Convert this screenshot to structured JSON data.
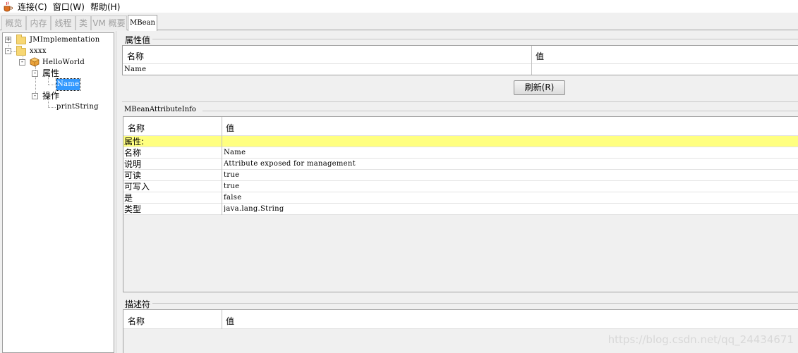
{
  "menubar": {
    "app_icon": "java-coffee-icon",
    "items": [
      "连接(C)",
      "窗口(W)",
      "帮助(H)"
    ]
  },
  "tabs": [
    "概览",
    "内存",
    "线程",
    "类",
    "VM 概要",
    "MBean"
  ],
  "tree": {
    "nodes": [
      "JMImplementation",
      "xxxx",
      "HelloWorld",
      "属性",
      "Name",
      "操作",
      "printString"
    ],
    "expanders": [
      "+",
      "-",
      "-",
      "-",
      "-"
    ]
  },
  "attr_values": {
    "title": "属性值",
    "columns": [
      "名称",
      "值"
    ],
    "rows": [
      {
        "name": "Name",
        "value": ""
      }
    ],
    "refresh_label": "刷新(R)"
  },
  "mbean_attr_info": {
    "title": "MBeanAttributeInfo",
    "columns": [
      "名称",
      "值"
    ],
    "section_row": "属性:",
    "rows": [
      {
        "name": "名称",
        "value": "Name"
      },
      {
        "name": "说明",
        "value": "Attribute exposed for management"
      },
      {
        "name": "可读",
        "value": "true"
      },
      {
        "name": "可写入",
        "value": "true"
      },
      {
        "name": "是",
        "value": "false"
      },
      {
        "name": "类型",
        "value": "java.lang.String"
      }
    ]
  },
  "descriptor": {
    "title": "描述符",
    "columns": [
      "名称",
      "值"
    ]
  },
  "watermark": "https://blog.csdn.net/qq_24434671",
  "colors": {
    "selection": "#3399ff",
    "highlight_row": "#ffff80"
  }
}
